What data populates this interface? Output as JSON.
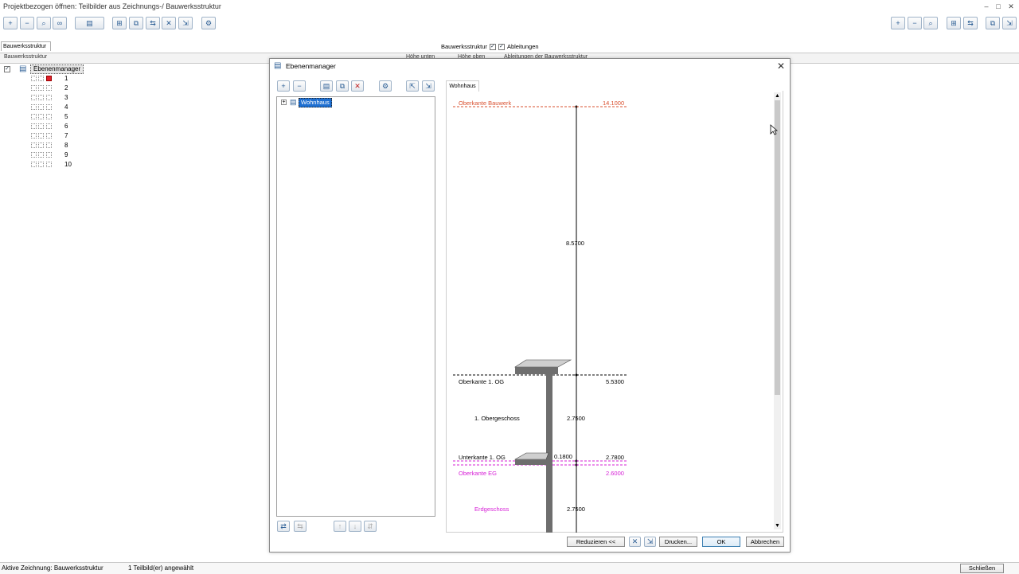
{
  "window": {
    "title": "Projektbezogen öffnen: Teilbilder aus Zeichnungs-/ Bauwerksstruktur",
    "controls": [
      "–",
      "□",
      "✕"
    ]
  },
  "main": {
    "tab": "Bauwerksstruktur",
    "header_left": "Bauwerksstruktur",
    "header_cols": [
      "Höhe unten",
      "Höhe oben",
      "Ableitungen der Bauwerksstruktur"
    ],
    "view_options": {
      "opt1": "Bauwerksstruktur",
      "opt2": "Ableitungen"
    },
    "tree": {
      "root_label": "Ebenenmanager",
      "items": [
        "1",
        "2",
        "3",
        "4",
        "5",
        "6",
        "7",
        "8",
        "9",
        "10"
      ]
    }
  },
  "dialog": {
    "title": "Ebenenmanager",
    "close": "✕",
    "tree_root": "Wohnhaus",
    "tree_expander": "+",
    "right_tab": "Wohnhaus",
    "levels": [
      {
        "name": "Oberkante Bauwerk",
        "value": "14.1000",
        "color": "#d9502f"
      },
      {
        "name": "Oberkante 1. OG",
        "value": "5.5300",
        "color": "#000000"
      },
      {
        "name": "Unterkante 1. OG",
        "value": "2.7800",
        "color": "#000000"
      },
      {
        "name": "Oberkante EG",
        "value": "2.6000",
        "color": "#d61fd6"
      }
    ],
    "floors": [
      {
        "name": "1. Obergeschoss",
        "color": "#000000"
      },
      {
        "name": "Erdgeschoss",
        "color": "#d61fd6"
      }
    ],
    "dims": {
      "top": "8.5700",
      "og_height": "2.7500",
      "slab": "0.1800",
      "eg_height": "2.7500"
    },
    "buttons": {
      "reduce": "Reduzieren <<",
      "print": "Drucken...",
      "ok": "OK",
      "cancel": "Abbrechen"
    }
  },
  "status": {
    "active_drawing": "Aktive Zeichnung: Bauwerksstruktur",
    "selected": "1 Teilbild(er) angewählt",
    "close_button": "Schließen"
  },
  "colors": {
    "accent": "#2a5d94",
    "selection": "#1e6fd1",
    "level_red": "#d9502f",
    "level_magenta": "#d61fd6"
  }
}
